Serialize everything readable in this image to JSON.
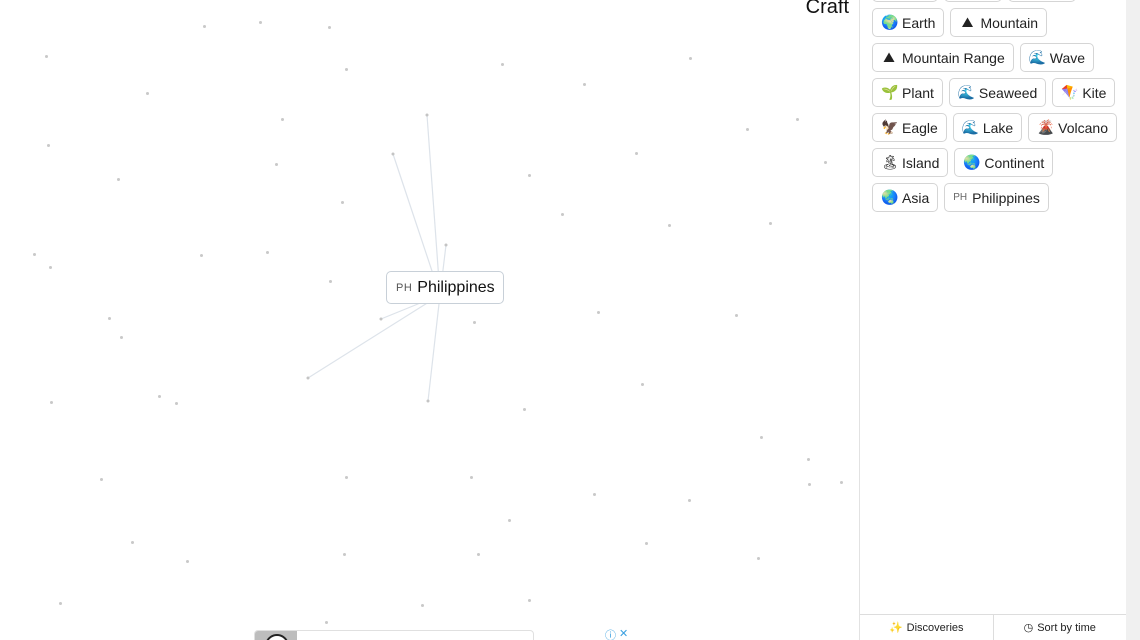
{
  "canvas": {
    "title": "Craft",
    "placed_item": {
      "code": "PH",
      "label": "Philippines"
    }
  },
  "sidebar": {
    "items": [
      {
        "icon": "globe-icon",
        "glyph": "🌍",
        "label": "Earth"
      },
      {
        "icon": "mountain-icon",
        "glyph": "⛰",
        "label": "Mountain"
      },
      {
        "icon": "mountain-icon",
        "glyph": "⛰",
        "label": "Mountain Range"
      },
      {
        "icon": "wave-icon",
        "glyph": "🌊",
        "label": "Wave"
      },
      {
        "icon": "plant-icon",
        "glyph": "🌱",
        "label": "Plant"
      },
      {
        "icon": "wave-icon",
        "glyph": "🌊",
        "label": "Seaweed"
      },
      {
        "icon": "kite-icon",
        "glyph": "🪁",
        "label": "Kite"
      },
      {
        "icon": "eagle-icon",
        "glyph": "🦅",
        "label": "Eagle"
      },
      {
        "icon": "wave-icon",
        "glyph": "🌊",
        "label": "Lake"
      },
      {
        "icon": "volcano-icon",
        "glyph": "🌋",
        "label": "Volcano"
      },
      {
        "icon": "island-icon",
        "glyph": "🏝",
        "label": "Island"
      },
      {
        "icon": "globe-icon",
        "glyph": "🌏",
        "label": "Continent"
      },
      {
        "icon": "globe-icon",
        "glyph": "🌏",
        "label": "Asia"
      },
      {
        "icon": "flag-code",
        "code": "PH",
        "label": "Philippines"
      }
    ],
    "footer": {
      "discoveries_label": "Discoveries",
      "sort_label": "Sort by time"
    }
  },
  "ad": {
    "info_glyph": "ⓘ",
    "close_glyph": "✕"
  }
}
